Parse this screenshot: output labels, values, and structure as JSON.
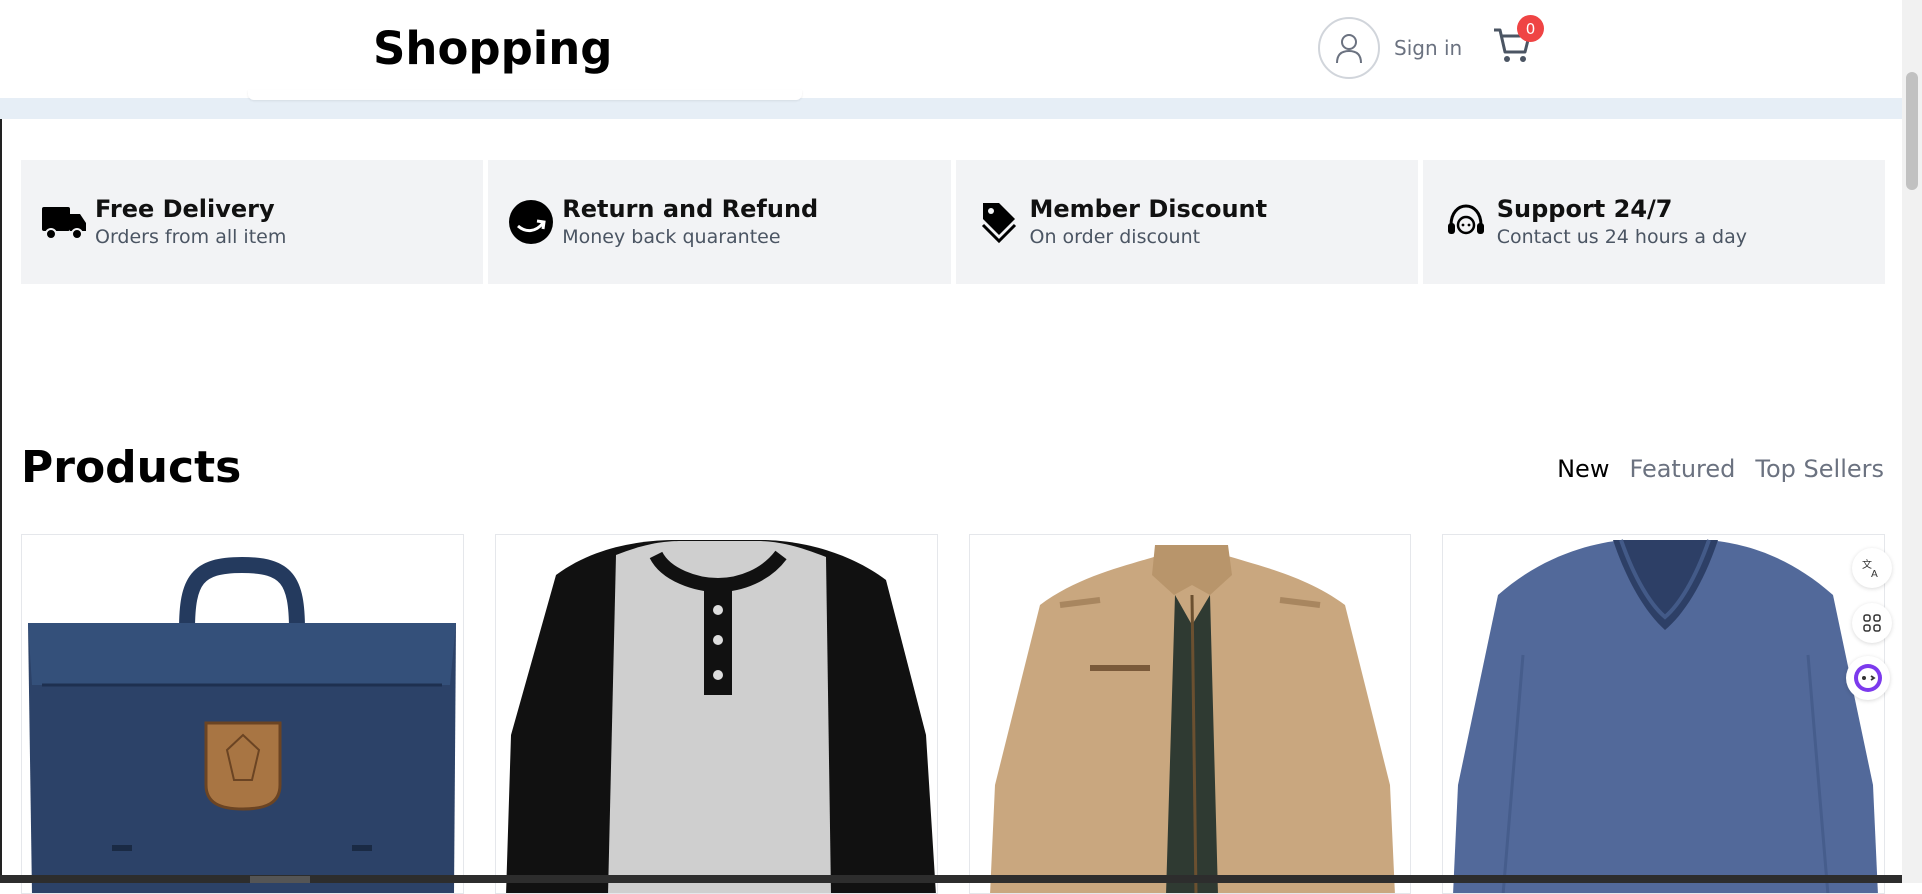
{
  "header": {
    "brand": "Shopping",
    "signin_label": "Sign in",
    "cart_count": "0"
  },
  "features": [
    {
      "title": "Free Delivery",
      "subtitle": "Orders from all item",
      "icon": "truck-icon"
    },
    {
      "title": "Return and Refund",
      "subtitle": "Money back quarantee",
      "icon": "refund-icon"
    },
    {
      "title": "Member Discount",
      "subtitle": "On order discount",
      "icon": "tag-icon"
    },
    {
      "title": "Support 24/7",
      "subtitle": "Contact us 24 hours a day",
      "icon": "headset-icon"
    }
  ],
  "products": {
    "title": "Products",
    "tabs": [
      "New",
      "Featured",
      "Top Sellers"
    ],
    "active_tab": "New",
    "items": [
      {
        "image": "navy backpack"
      },
      {
        "image": "raglan henley shirt"
      },
      {
        "image": "khaki jacket"
      },
      {
        "image": "blue v-neck sweater"
      }
    ]
  },
  "colors": {
    "badge": "#ef4444",
    "feature_bg": "#f2f3f5",
    "band": "#e6eef6"
  }
}
